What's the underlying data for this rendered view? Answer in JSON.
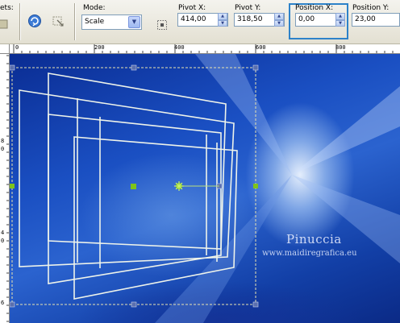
{
  "toolbar": {
    "presets_label_partial": "ets:",
    "mode_label": "Mode:",
    "mode_value": "Scale",
    "pivot_x_label": "Pivot X:",
    "pivot_x_value": "414,00",
    "pivot_y_label": "Pivot Y:",
    "pivot_y_value": "318,50",
    "position_x_label": "Position X:",
    "position_x_value": "0,00",
    "position_y_label": "Position Y:",
    "position_y_value": "23,00",
    "icons": [
      "preset-icon",
      "apply-icon",
      "reset-icon",
      "mode-dropdown-arrow-icon",
      "pivot-origin-icon",
      "spin-up-icon",
      "spin-down-icon"
    ]
  },
  "ruler": {
    "h_labels": [
      "0",
      "200",
      "400",
      "600",
      "800"
    ],
    "v_labels": [
      "8",
      "0",
      "4",
      "0",
      "6"
    ]
  },
  "canvas": {
    "watermark_title": "Pinuccia",
    "watermark_url": "www.maidiregrafica.eu",
    "selection_line_color": "#f0f0f0",
    "handle_color": "#7ec31a",
    "bounding_box_color": "#e8e2b0"
  }
}
